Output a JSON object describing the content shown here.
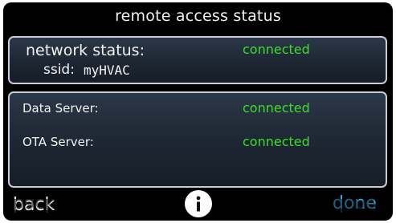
{
  "screen": {
    "title": "remote access status"
  },
  "network": {
    "status_label": "network status:",
    "status_value": "connected",
    "ssid_label": "ssid:",
    "ssid_value": "myHVAC"
  },
  "servers": {
    "data_server_label": "Data Server:",
    "data_server_value": "connected",
    "ota_server_label": "OTA Server:",
    "ota_server_value": "connected"
  },
  "footer": {
    "back_label": "back",
    "info_icon": "info-icon",
    "done_label": "done"
  },
  "colors": {
    "connected": "#3ddc2a",
    "done": "#3aa6dc",
    "background": "#000000",
    "panel_border": "#c8ccd4"
  }
}
